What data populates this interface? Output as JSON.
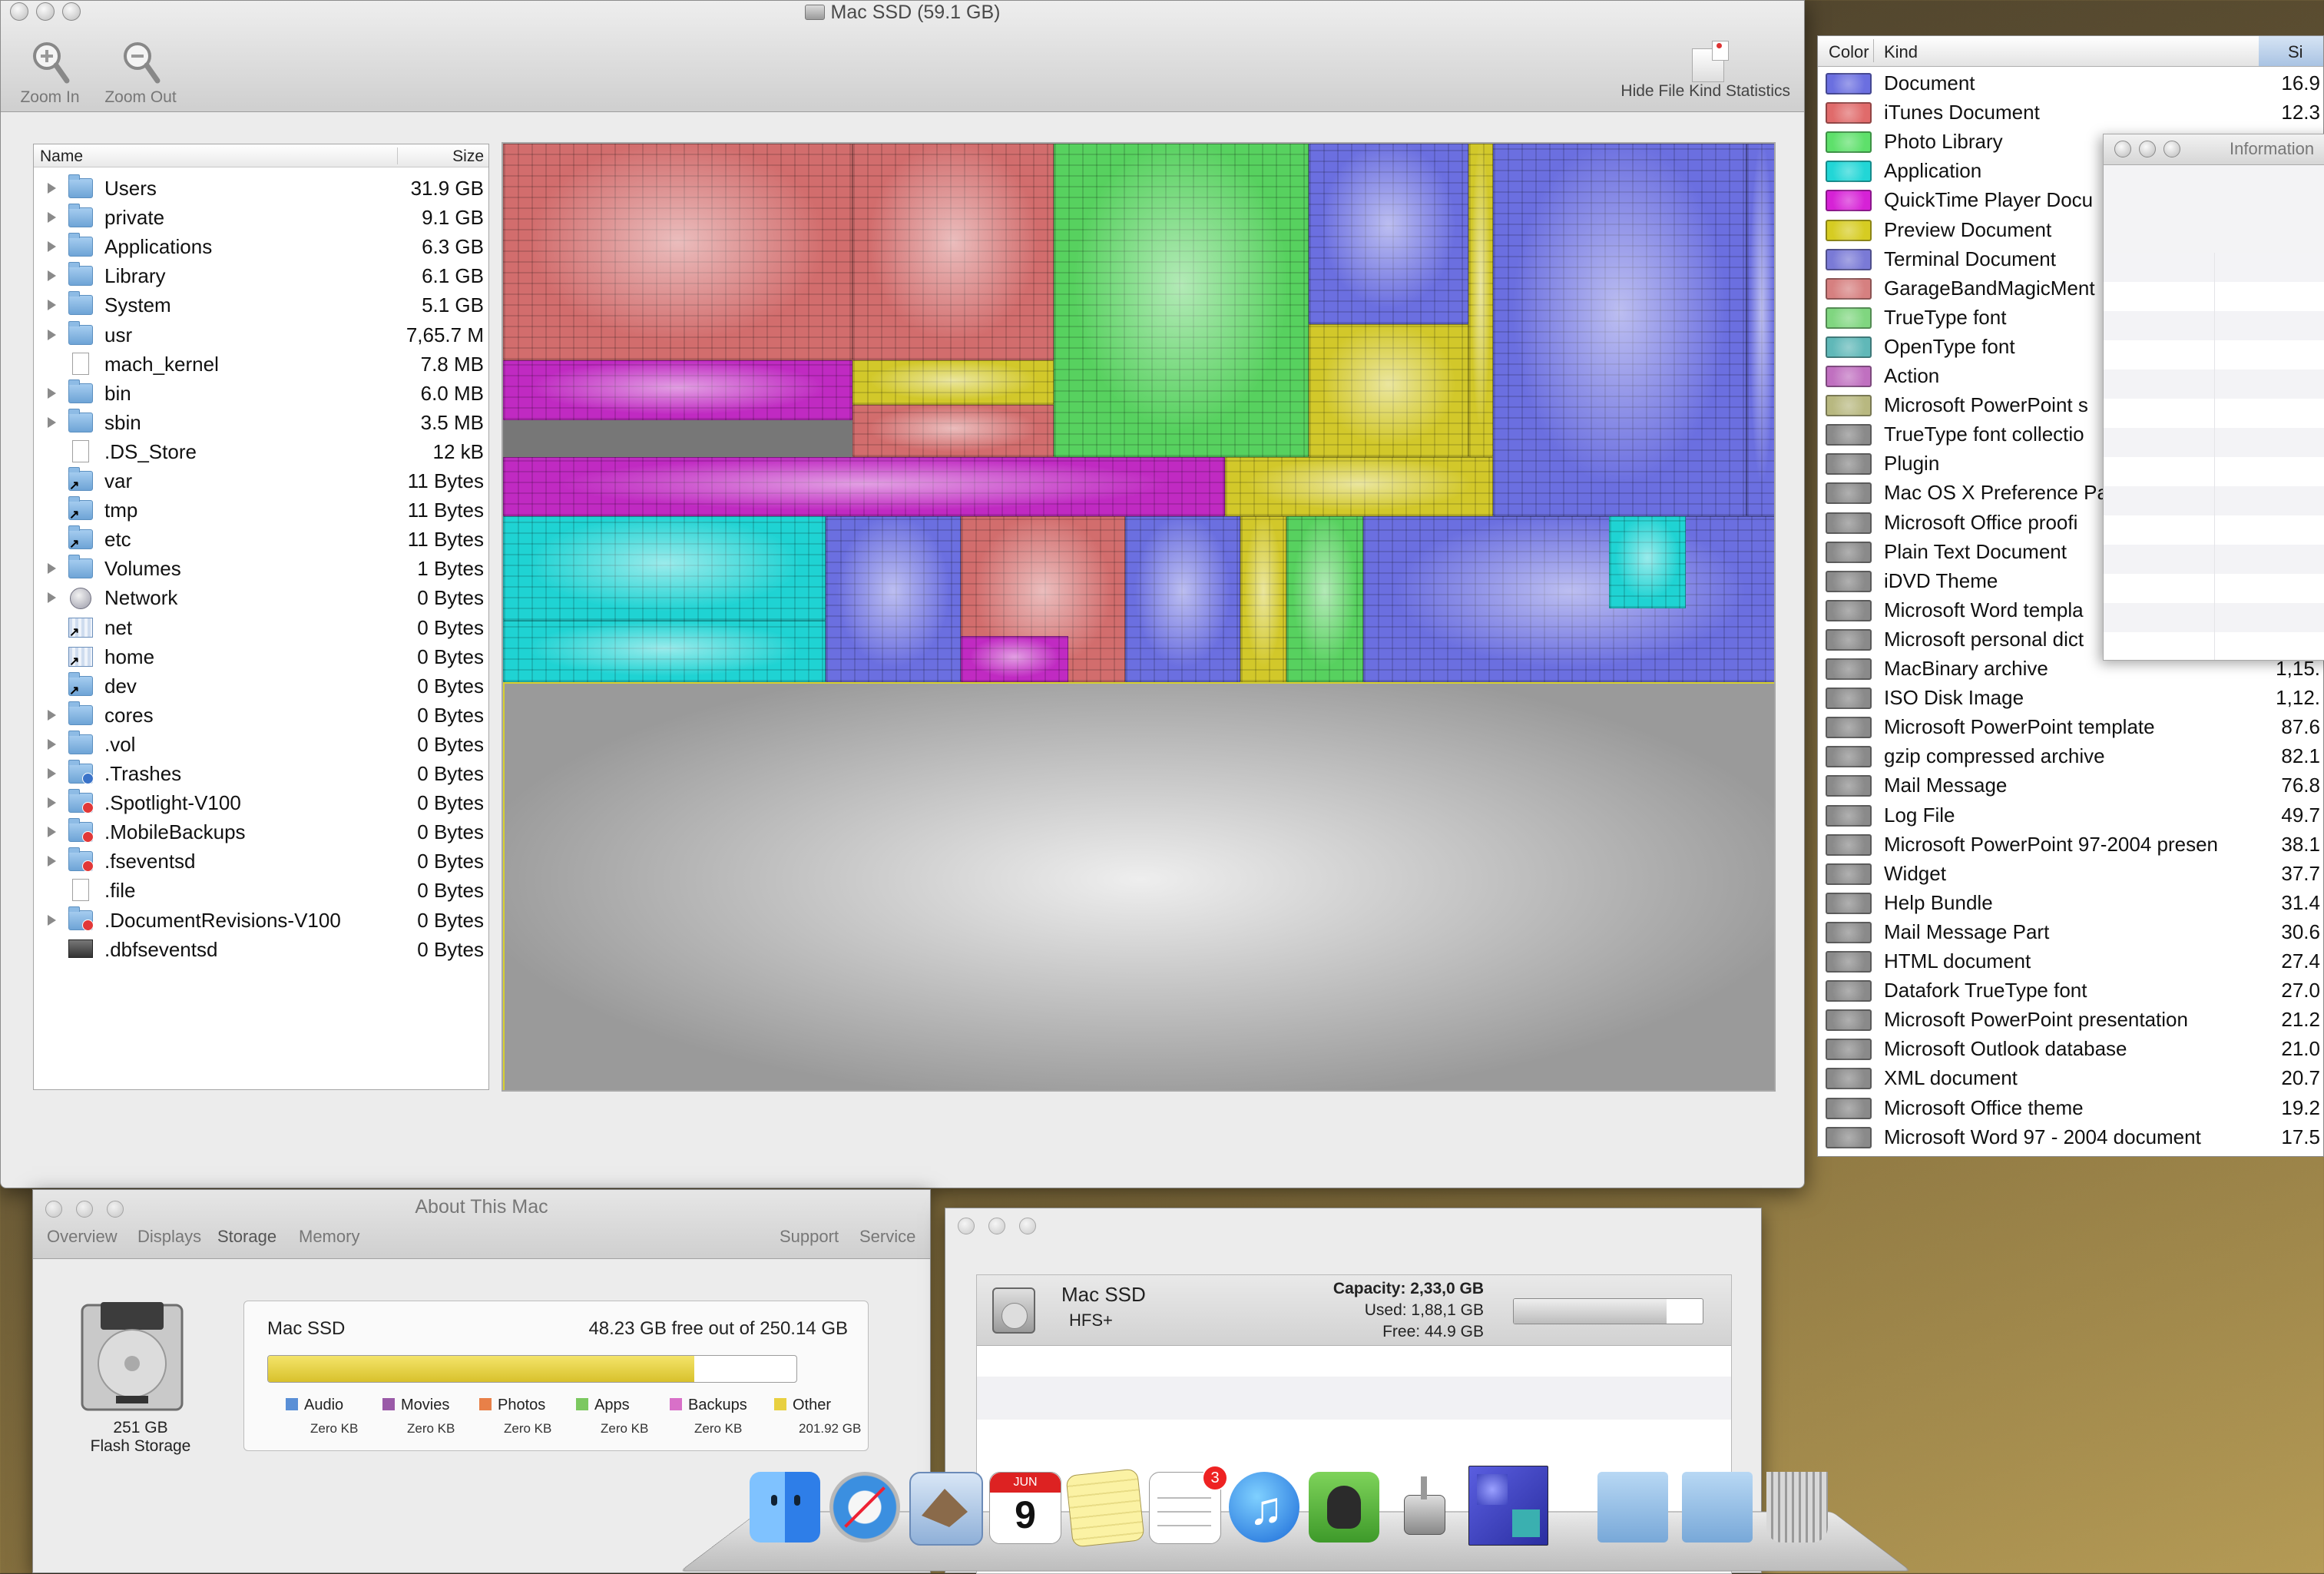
{
  "main_window": {
    "title": "Mac SSD (59.1 GB)",
    "toolbar": {
      "zoom_in": "Zoom In",
      "zoom_out": "Zoom Out",
      "hide_stats": "Hide File Kind Statistics"
    },
    "file_list": {
      "columns": {
        "name": "Name",
        "size": "Size"
      },
      "rows": [
        {
          "name": "Users",
          "size": "31.9 GB",
          "icon": "folder-icon",
          "expandable": true
        },
        {
          "name": "private",
          "size": "9.1 GB",
          "icon": "folder-icon",
          "expandable": true
        },
        {
          "name": "Applications",
          "size": "6.3 GB",
          "icon": "folder-icon",
          "expandable": true
        },
        {
          "name": "Library",
          "size": "6.1 GB",
          "icon": "folder-icon",
          "expandable": true
        },
        {
          "name": "System",
          "size": "5.1 GB",
          "icon": "folder-icon",
          "expandable": true
        },
        {
          "name": "usr",
          "size": "7,65.7 M",
          "icon": "folder-icon",
          "expandable": true
        },
        {
          "name": "mach_kernel",
          "size": "7.8 MB",
          "icon": "document-icon",
          "expandable": false
        },
        {
          "name": "bin",
          "size": "6.0 MB",
          "icon": "folder-icon",
          "expandable": true
        },
        {
          "name": "sbin",
          "size": "3.5 MB",
          "icon": "folder-icon",
          "expandable": true
        },
        {
          "name": ".DS_Store",
          "size": "12 kB",
          "icon": "document-icon",
          "expandable": false
        },
        {
          "name": "var",
          "size": "11 Bytes",
          "icon": "alias-folder-icon",
          "expandable": false
        },
        {
          "name": "tmp",
          "size": "11 Bytes",
          "icon": "alias-folder-icon",
          "expandable": false
        },
        {
          "name": "etc",
          "size": "11 Bytes",
          "icon": "alias-folder-icon",
          "expandable": false
        },
        {
          "name": "Volumes",
          "size": "1 Bytes",
          "icon": "folder-icon",
          "expandable": true
        },
        {
          "name": "Network",
          "size": "0 Bytes",
          "icon": "network-globe-icon",
          "expandable": true
        },
        {
          "name": "net",
          "size": "0 Bytes",
          "icon": "network-folder-icon",
          "expandable": false
        },
        {
          "name": "home",
          "size": "0 Bytes",
          "icon": "network-folder-icon",
          "expandable": false
        },
        {
          "name": "dev",
          "size": "0 Bytes",
          "icon": "alias-folder-icon",
          "expandable": false
        },
        {
          "name": "cores",
          "size": "0 Bytes",
          "icon": "folder-icon",
          "expandable": true
        },
        {
          "name": ".vol",
          "size": "0 Bytes",
          "icon": "folder-icon",
          "expandable": true
        },
        {
          "name": ".Trashes",
          "size": "0 Bytes",
          "icon": "dropbox-folder-icon",
          "expandable": true
        },
        {
          "name": ".Spotlight-V100",
          "size": "0 Bytes",
          "icon": "restricted-folder-icon",
          "expandable": true
        },
        {
          "name": ".MobileBackups",
          "size": "0 Bytes",
          "icon": "restricted-folder-icon",
          "expandable": true
        },
        {
          "name": ".fseventsd",
          "size": "0 Bytes",
          "icon": "restricted-folder-icon",
          "expandable": true
        },
        {
          "name": ".file",
          "size": "0 Bytes",
          "icon": "document-icon",
          "expandable": false
        },
        {
          "name": ".DocumentRevisions-V100",
          "size": "0 Bytes",
          "icon": "restricted-folder-icon",
          "expandable": true
        },
        {
          "name": ".dbfseventsd",
          "size": "0 Bytes",
          "icon": "executable-icon",
          "expandable": false
        }
      ]
    }
  },
  "kind_stats": {
    "columns": {
      "color": "Color",
      "kind": "Kind",
      "size": "Si"
    },
    "rows": [
      {
        "kind": "Document",
        "size": "16.9",
        "color": "#6b6fe0"
      },
      {
        "kind": "iTunes Document",
        "size": "12.3",
        "color": "#e06b6b"
      },
      {
        "kind": "Photo Library",
        "size": "",
        "color": "#5ee06b"
      },
      {
        "kind": "Application",
        "size": "",
        "color": "#22d6d6"
      },
      {
        "kind": "QuickTime Player Docu",
        "size": "",
        "color": "#d622d6"
      },
      {
        "kind": "Preview Document",
        "size": "",
        "color": "#d6cc22"
      },
      {
        "kind": "Terminal Document",
        "size": "",
        "color": "#7a7ad6"
      },
      {
        "kind": "GarageBandMagicMent",
        "size": "",
        "color": "#d68080"
      },
      {
        "kind": "TrueType font",
        "size": "",
        "color": "#80d680"
      },
      {
        "kind": "OpenType font",
        "size": "",
        "color": "#60b8b8"
      },
      {
        "kind": "Action",
        "size": "",
        "color": "#c070c0"
      },
      {
        "kind": "Microsoft PowerPoint s",
        "size": "",
        "color": "#b8b880"
      },
      {
        "kind": "TrueType font collectio",
        "size": "",
        "color": "#8a8a8a"
      },
      {
        "kind": "Plugin",
        "size": "",
        "color": "#8a8a8a"
      },
      {
        "kind": "Mac OS X Preference Pa",
        "size": "",
        "color": "#8a8a8a"
      },
      {
        "kind": "Microsoft Office proofi",
        "size": "",
        "color": "#8a8a8a"
      },
      {
        "kind": "Plain Text Document",
        "size": "",
        "color": "#8a8a8a"
      },
      {
        "kind": "iDVD Theme",
        "size": "",
        "color": "#8a8a8a"
      },
      {
        "kind": "Microsoft Word templa",
        "size": "",
        "color": "#8a8a8a"
      },
      {
        "kind": "Microsoft personal dict",
        "size": "",
        "color": "#8a8a8a"
      },
      {
        "kind": "MacBinary archive",
        "size": "1,15.",
        "color": "#8a8a8a"
      },
      {
        "kind": "ISO Disk Image",
        "size": "1,12.",
        "color": "#8a8a8a"
      },
      {
        "kind": "Microsoft PowerPoint template",
        "size": "87.6",
        "color": "#8a8a8a"
      },
      {
        "kind": "gzip compressed archive",
        "size": "82.1",
        "color": "#8a8a8a"
      },
      {
        "kind": "Mail Message",
        "size": "76.8",
        "color": "#8a8a8a"
      },
      {
        "kind": "Log File",
        "size": "49.7",
        "color": "#8a8a8a"
      },
      {
        "kind": "Microsoft PowerPoint 97-2004 presen",
        "size": "38.1",
        "color": "#8a8a8a"
      },
      {
        "kind": "Widget",
        "size": "37.7",
        "color": "#8a8a8a"
      },
      {
        "kind": "Help Bundle",
        "size": "31.4",
        "color": "#8a8a8a"
      },
      {
        "kind": "Mail Message Part",
        "size": "30.6",
        "color": "#8a8a8a"
      },
      {
        "kind": "HTML document",
        "size": "27.4",
        "color": "#8a8a8a"
      },
      {
        "kind": "Datafork TrueType font",
        "size": "27.0",
        "color": "#8a8a8a"
      },
      {
        "kind": "Microsoft PowerPoint presentation",
        "size": "21.2",
        "color": "#8a8a8a"
      },
      {
        "kind": "Microsoft Outlook database",
        "size": "21.0",
        "color": "#8a8a8a"
      },
      {
        "kind": "XML document",
        "size": "20.7",
        "color": "#8a8a8a"
      },
      {
        "kind": "Microsoft Office theme",
        "size": "19.2",
        "color": "#8a8a8a"
      },
      {
        "kind": "Microsoft Word 97 - 2004 document",
        "size": "17.5",
        "color": "#8a8a8a"
      }
    ]
  },
  "info_window": {
    "title": "Information"
  },
  "about_mac": {
    "title": "About This Mac",
    "tabs": [
      "Overview",
      "Displays",
      "Storage",
      "Memory"
    ],
    "selected_tab": "Storage",
    "links": [
      "Support",
      "Service"
    ],
    "drive": {
      "capacity": "251 GB",
      "type": "Flash Storage"
    },
    "volume": {
      "name": "Mac SSD",
      "free_text": "48.23 GB free out of 250.14 GB",
      "used_fraction": 0.807
    },
    "legend": [
      {
        "label": "Audio",
        "value": "Zero KB",
        "color": "#5a8fd6"
      },
      {
        "label": "Movies",
        "value": "Zero KB",
        "color": "#9a5aa8"
      },
      {
        "label": "Photos",
        "value": "Zero KB",
        "color": "#e88048"
      },
      {
        "label": "Apps",
        "value": "Zero KB",
        "color": "#7cc860"
      },
      {
        "label": "Backups",
        "value": "Zero KB",
        "color": "#d870c8"
      },
      {
        "label": "Other",
        "value": "201.92 GB",
        "color": "#e8d040"
      }
    ]
  },
  "disk_window": {
    "name": "Mac SSD",
    "format": "HFS+",
    "capacity": "Capacity: 2,33,0 GB",
    "used": "Used: 1,88,1 GB",
    "free": "Free: 44.9 GB",
    "used_fraction": 0.81
  },
  "dock": {
    "items": [
      "finder-icon",
      "safari-icon",
      "mail-icon",
      "calendar-icon",
      "notes-icon",
      "reminders-icon",
      "itunes-icon",
      "evernote-icon",
      "utility-icon",
      "grandperspective-icon",
      "applications-stack-icon",
      "dropbox-stack-icon",
      "trash-icon"
    ],
    "calendar_date": "9",
    "calendar_month": "JUN",
    "reminders_badge": "3"
  },
  "colors": {
    "treemap_document": "#6b6fe0",
    "treemap_itunes": "#d26d6d",
    "treemap_photo": "#57d15f",
    "treemap_app": "#1fd3d3",
    "treemap_quicktime": "#c02ac2",
    "treemap_preview": "#d2c82a",
    "treemap_other": "#9a9a9a"
  }
}
